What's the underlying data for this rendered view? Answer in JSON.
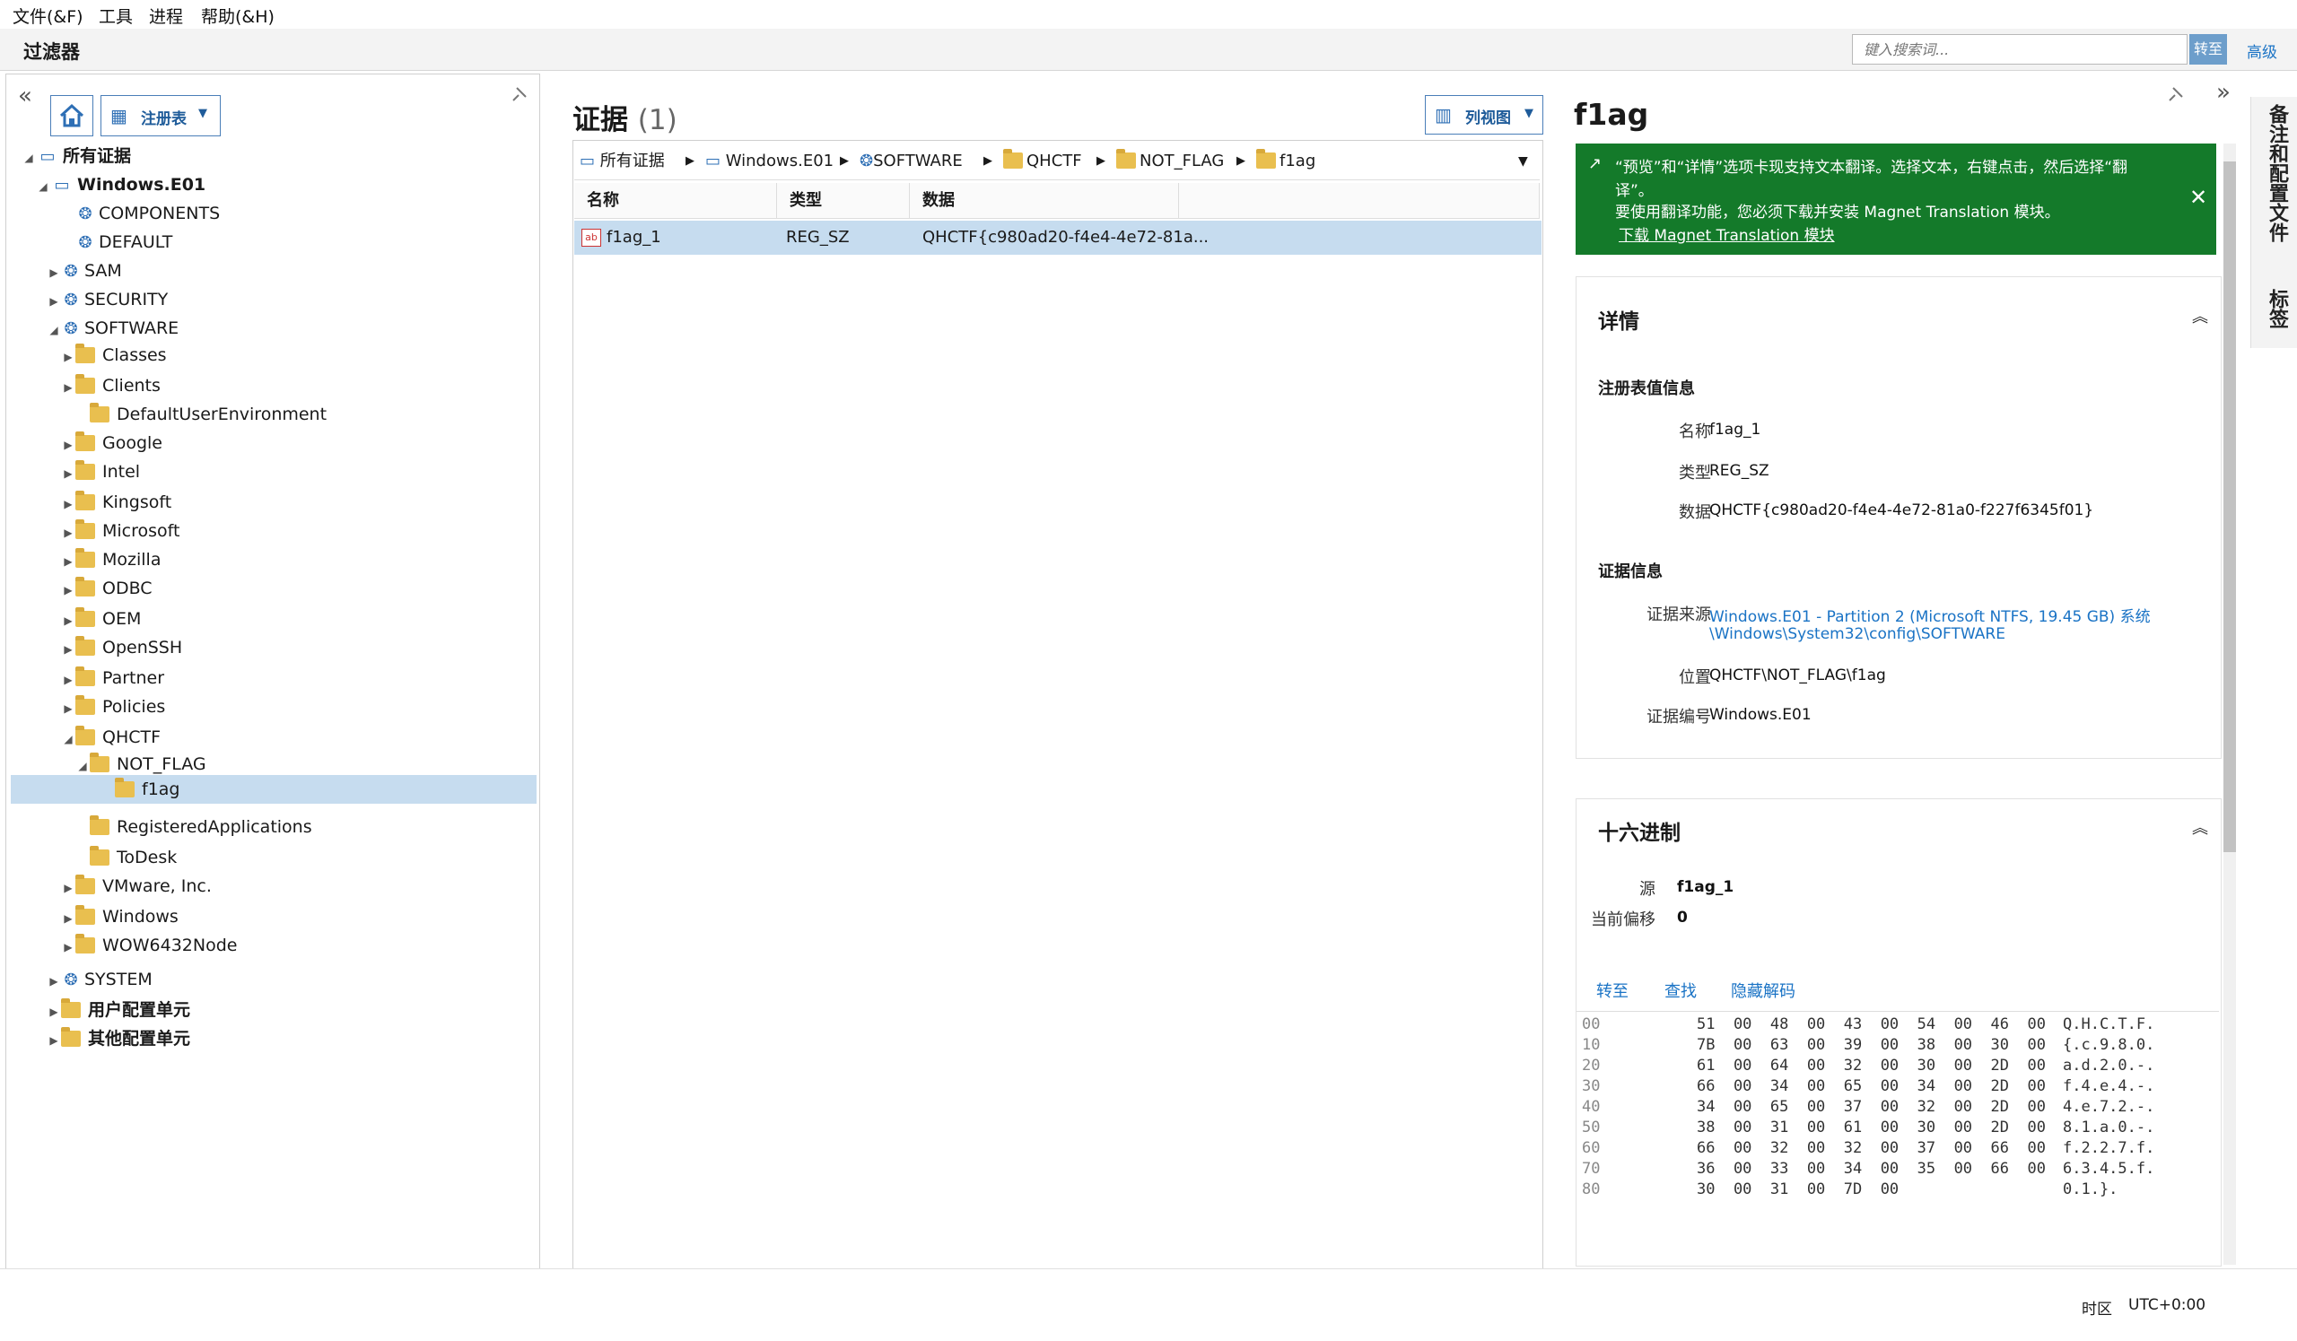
{
  "menu": [
    "文件(&F)",
    "工具",
    "进程",
    "帮助(&H)"
  ],
  "filter": {
    "title": "过滤器",
    "search_placeholder": "键入搜索词...",
    "goto_label": "转至",
    "advanced_label": "高级"
  },
  "left": {
    "collapse_icon": "«",
    "home_icon": "home-icon",
    "registry_label": "注册表"
  },
  "tree": [
    {
      "label": "所有证据",
      "bold": true
    },
    {
      "label": "Windows.E01",
      "bold": true
    },
    {
      "label": "COMPONENTS"
    },
    {
      "label": "DEFAULT"
    },
    {
      "label": "SAM"
    },
    {
      "label": "SECURITY"
    },
    {
      "label": "SOFTWARE"
    },
    {
      "label": "Classes"
    },
    {
      "label": "Clients"
    },
    {
      "label": "DefaultUserEnvironment"
    },
    {
      "label": "Google"
    },
    {
      "label": "Intel"
    },
    {
      "label": "Kingsoft"
    },
    {
      "label": "Microsoft"
    },
    {
      "label": "Mozilla"
    },
    {
      "label": "ODBC"
    },
    {
      "label": "OEM"
    },
    {
      "label": "OpenSSH"
    },
    {
      "label": "Partner"
    },
    {
      "label": "Policies"
    },
    {
      "label": "QHCTF"
    },
    {
      "label": "NOT_FLAG"
    },
    {
      "label": "f1ag",
      "selected": true
    },
    {
      "label": "RegisteredApplications"
    },
    {
      "label": "ToDesk"
    },
    {
      "label": "VMware, Inc."
    },
    {
      "label": "Windows"
    },
    {
      "label": "WOW6432Node"
    },
    {
      "label": "SYSTEM"
    },
    {
      "label": "用户配置单元",
      "bold": true
    },
    {
      "label": "其他配置单元",
      "bold": true
    }
  ],
  "middle": {
    "title": "证据",
    "count": "(1)",
    "view_label": "列视图",
    "breadcrumb": [
      "所有证据",
      "Windows.E01",
      "SOFTWARE",
      "QHCTF",
      "NOT_FLAG",
      "f1ag"
    ],
    "columns": [
      "名称",
      "类型",
      "数据"
    ],
    "rows": [
      {
        "name": "f1ag_1",
        "type": "REG_SZ",
        "data": "QHCTF{c980ad20-f4e4-4e72-81a..."
      }
    ]
  },
  "right": {
    "title": "f1ag",
    "banner": {
      "line1": "“预览”和“详情”选项卡现支持文本翻译。选择文本，右键点击，然后选择“翻",
      "line2": "译”。",
      "line3": "要使用翻译功能，您必须下载并安装 Magnet Translation 模块。",
      "link": "下载 Magnet Translation 模块"
    },
    "details": {
      "title": "详情",
      "reg_section": "注册表值信息",
      "name_key": "名称",
      "name_val": "f1ag_1",
      "type_key": "类型",
      "type_val": "REG_SZ",
      "data_key": "数据",
      "data_val": "QHCTF{c980ad20-f4e4-4e72-81a0-f227f6345f01}",
      "ev_section": "证据信息",
      "source_key": "证据来源",
      "source_val1": "Windows.E01 - Partition 2 (Microsoft NTFS, 19.45 GB) 系统",
      "source_val2": "\\Windows\\System32\\config\\SOFTWARE",
      "loc_key": "位置",
      "loc_val": "QHCTF\\NOT_FLAG\\f1ag",
      "num_key": "证据编号",
      "num_val": "Windows.E01"
    },
    "hex": {
      "title": "十六进制",
      "source_key": "源",
      "source_val": "f1ag_1",
      "offset_key": "当前偏移",
      "offset_val": "0",
      "actions": [
        "转至",
        "查找",
        "隐藏解码"
      ],
      "rows": [
        {
          "off": "00",
          "bytes": "51  00  48  00  43  00  54  00  46  00",
          "text": "Q.H.C.T.F."
        },
        {
          "off": "10",
          "bytes": "7B  00  63  00  39  00  38  00  30  00",
          "text": "{.c.9.8.0."
        },
        {
          "off": "20",
          "bytes": "61  00  64  00  32  00  30  00  2D  00",
          "text": "a.d.2.0.-."
        },
        {
          "off": "30",
          "bytes": "66  00  34  00  65  00  34  00  2D  00",
          "text": "f.4.e.4.-."
        },
        {
          "off": "40",
          "bytes": "34  00  65  00  37  00  32  00  2D  00",
          "text": "4.e.7.2.-."
        },
        {
          "off": "50",
          "bytes": "38  00  31  00  61  00  30  00  2D  00",
          "text": "8.1.a.0.-."
        },
        {
          "off": "60",
          "bytes": "66  00  32  00  32  00  37  00  66  00",
          "text": "f.2.2.7.f."
        },
        {
          "off": "70",
          "bytes": "36  00  33  00  34  00  35  00  66  00",
          "text": "6.3.4.5.f."
        },
        {
          "off": "80",
          "bytes": "30  00  31  00  7D  00",
          "text": "0.1.}."
        }
      ]
    },
    "side_tab_label": "备注和配置文件",
    "side_tab_label2": "标签"
  },
  "status": {
    "tz_label": "时区",
    "tz_val": "UTC+0:00"
  },
  "colors": {
    "accent": "#1a73c5",
    "banner": "#147a2a",
    "selection": "#c6dcef"
  }
}
